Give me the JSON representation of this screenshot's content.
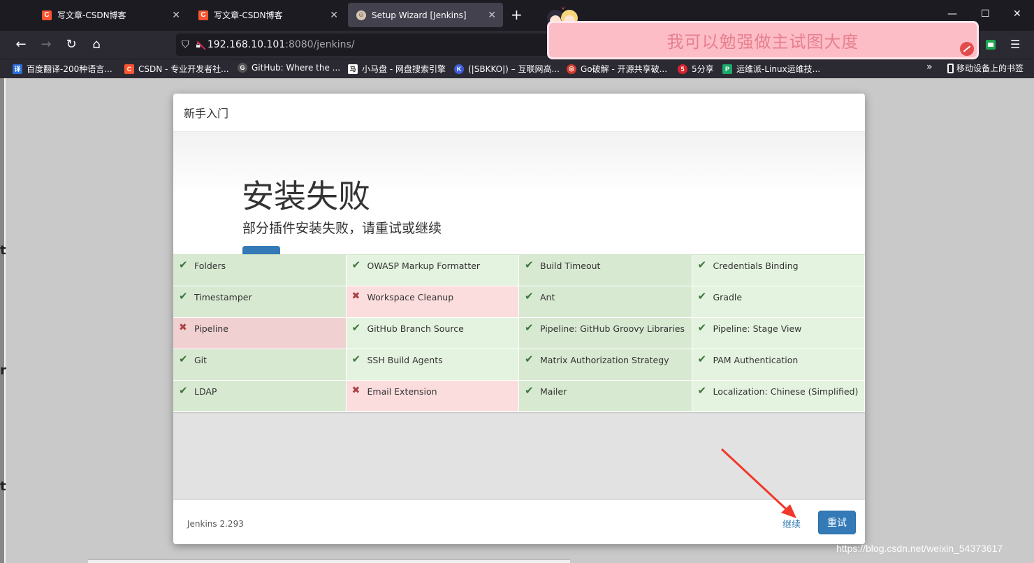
{
  "browser": {
    "tabs": [
      {
        "title": "写文章-CSDN博客",
        "favicon": "C",
        "active": false
      },
      {
        "title": "写文章-CSDN博客",
        "favicon": "C",
        "active": false
      },
      {
        "title": "Setup Wizard [Jenkins]",
        "favicon": "jenkins",
        "active": true
      }
    ],
    "new_tab": "+",
    "url_host": "192.168.10.101",
    "url_path": ":8080/jenkins/",
    "bookmarks": [
      {
        "label": "百度翻译-200种语言...",
        "icon": "译",
        "color": "#2a6dd9"
      },
      {
        "label": "CSDN - 专业开发者社...",
        "icon": "C",
        "color": "#fc5531"
      },
      {
        "label": "GitHub: Where the ...",
        "icon": "G",
        "color": "#555555"
      },
      {
        "label": "小马盘 - 网盘搜索引擎",
        "icon": "马",
        "color": "#222222"
      },
      {
        "label": "(|SBKKO|) – 互联网高...",
        "icon": "K",
        "color": "#3f5bd9"
      },
      {
        "label": "Go破解 - 开源共享破...",
        "icon": "◎",
        "color": "#d33a2c"
      },
      {
        "label": "5分享",
        "icon": "5",
        "color": "#d9232d"
      },
      {
        "label": "运维派-Linux运维技...",
        "icon": "P",
        "color": "#1ea86a"
      }
    ],
    "mobile_bookmarks": "移动设备上的书签"
  },
  "notice": {
    "text": "我可以勉强做主试图大度"
  },
  "dialog": {
    "header": "新手入门",
    "title": "安装失败",
    "subtitle": "部分插件安装失败，请重试或继续",
    "plugins": [
      {
        "name": "Folders",
        "status": "ok"
      },
      {
        "name": "OWASP Markup Formatter",
        "status": "ok"
      },
      {
        "name": "Build Timeout",
        "status": "ok"
      },
      {
        "name": "Credentials Binding",
        "status": "ok"
      },
      {
        "name": "Timestamper",
        "status": "ok"
      },
      {
        "name": "Workspace Cleanup",
        "status": "fail"
      },
      {
        "name": "Ant",
        "status": "ok"
      },
      {
        "name": "Gradle",
        "status": "ok"
      },
      {
        "name": "Pipeline",
        "status": "fail"
      },
      {
        "name": "GitHub Branch Source",
        "status": "ok"
      },
      {
        "name": "Pipeline: GitHub Groovy Libraries",
        "status": "ok"
      },
      {
        "name": "Pipeline: Stage View",
        "status": "ok"
      },
      {
        "name": "Git",
        "status": "ok"
      },
      {
        "name": "SSH Build Agents",
        "status": "ok"
      },
      {
        "name": "Matrix Authorization Strategy",
        "status": "ok"
      },
      {
        "name": "PAM Authentication",
        "status": "ok"
      },
      {
        "name": "LDAP",
        "status": "ok"
      },
      {
        "name": "Email Extension",
        "status": "fail"
      },
      {
        "name": "Mailer",
        "status": "ok"
      },
      {
        "name": "Localization: Chinese (Simplified)",
        "status": "ok"
      }
    ],
    "version": "Jenkins 2.293",
    "continue_label": "继续",
    "retry_label": "重试"
  },
  "watermark": "https://blog.csdn.net/weixin_54373617",
  "colors": {
    "primary": "#337ab7",
    "success_bg": "#e4f3df",
    "fail_bg": "#fcdddd",
    "arrow": "#f0392b"
  }
}
